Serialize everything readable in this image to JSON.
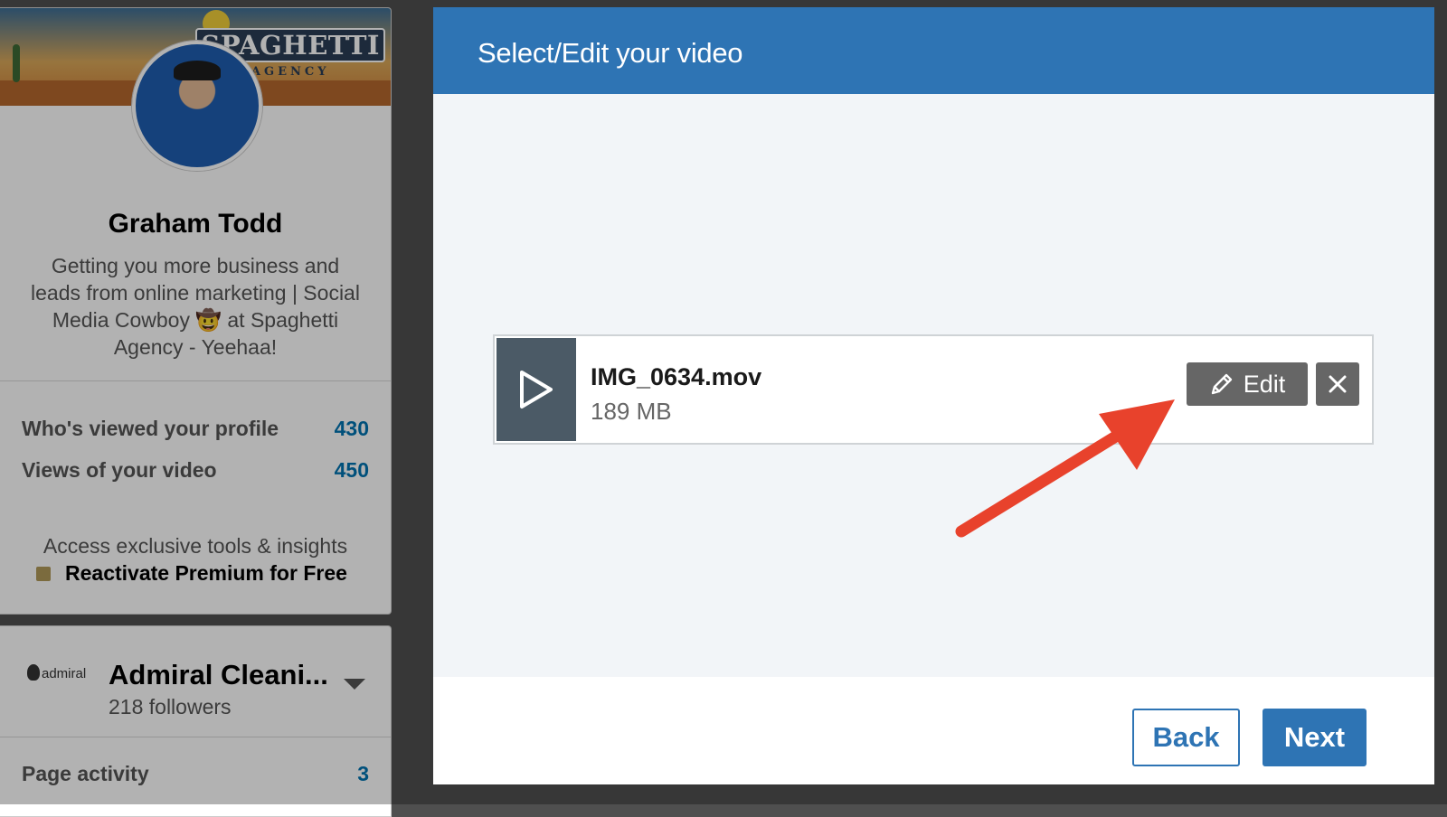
{
  "profile": {
    "brand_main": "SPAGHETTI",
    "brand_sub": "AGENCY",
    "name": "Graham Todd",
    "headline_line1": "Getting you more business and",
    "headline_line2": "leads from online marketing | Social",
    "headline_line3": "Media Cowboy 🤠  at Spaghetti",
    "headline_line4": "Agency - Yeehaa!",
    "stats": [
      {
        "label": "Who's viewed your profile",
        "value": "430"
      },
      {
        "label": "Views of your video",
        "value": "450"
      }
    ],
    "premium_text": "Access exclusive tools & insights",
    "premium_link": "Reactivate Premium for Free"
  },
  "company": {
    "logo_text": "admiral",
    "name": "Admiral Cleani...",
    "followers": "218 followers",
    "page_activity_label": "Page activity",
    "page_activity_value": "3"
  },
  "modal": {
    "title": "Select/Edit your video",
    "video": {
      "file_name": "IMG_0634.mov",
      "file_size": "189 MB",
      "edit_label": "Edit"
    },
    "footer": {
      "back_label": "Back",
      "next_label": "Next"
    }
  },
  "icons": {
    "play": "play-icon",
    "pencil": "pencil-icon",
    "close": "close-icon",
    "chevron": "chevron-down-icon"
  },
  "colors": {
    "header_blue": "#2e74b4",
    "annotation_arrow": "#e8422c",
    "button_gray": "#666666",
    "thumb_slate": "#4b5a66"
  }
}
